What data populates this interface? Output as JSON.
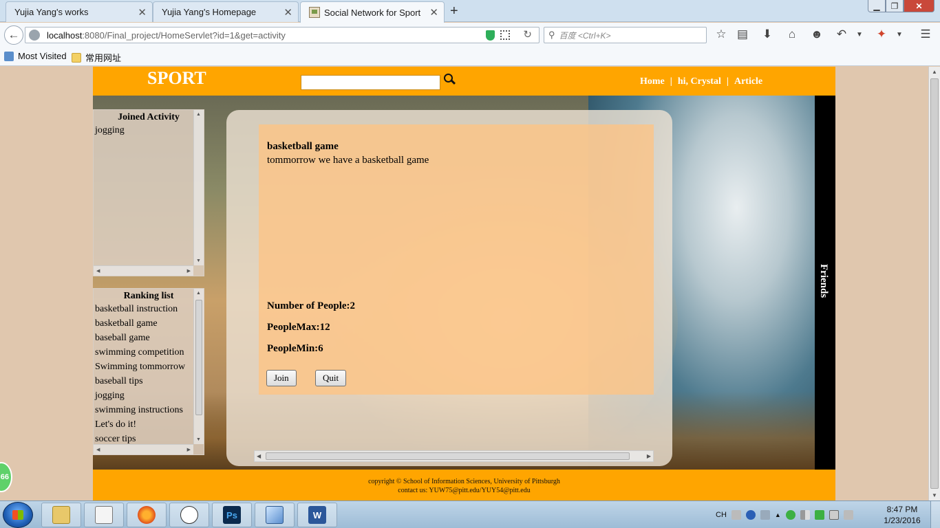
{
  "browser": {
    "tabs": [
      {
        "title": "Yujia Yang's works",
        "active": false
      },
      {
        "title": "Yujia Yang's Homepage",
        "active": false
      },
      {
        "title": "Social Network for Sport",
        "active": true
      }
    ],
    "url_host": "localhost",
    "url_rest": ":8080/Final_project/HomeServlet?id=1&get=activity",
    "search_placeholder": "百度 <Ctrl+K>",
    "bookmarks": [
      "Most Visited",
      "常用网址"
    ]
  },
  "site": {
    "logo": "SPORT",
    "nav": {
      "home": "Home",
      "sep1": "|",
      "user": "hi, Crystal",
      "sep2": "|",
      "article": "Article"
    },
    "friends_label": "Friends",
    "footer": {
      "line1": "copyright © School of Information Sciences, University of Pittsburgh",
      "line2": "contact us: YUW75@pitt.edu/YUY54@pitt.edu"
    }
  },
  "joined_activity": {
    "title": "Joined Activity",
    "items": [
      "jogging"
    ]
  },
  "ranking_list": {
    "title": "Ranking list",
    "items": [
      "basketball instruction",
      "basketball game",
      "baseball game",
      "swimming competition",
      "Swimming tommorrow",
      "baseball tips",
      "jogging",
      "swimming instructions",
      "Let's do it!",
      "soccer tips"
    ]
  },
  "activity": {
    "title": "basketball game",
    "description": "tommorrow we have a basketball game",
    "num_people": "Number of People:2",
    "people_max": "PeopleMax:12",
    "people_min": "PeopleMin:6",
    "join_label": "Join",
    "quit_label": "Quit"
  },
  "badge": "66",
  "taskbar": {
    "apps": [
      "file-explorer",
      "notepad",
      "firefox",
      "rabbit-app",
      "photoshop",
      "3d-box-app",
      "word"
    ],
    "tray_lang": "CH",
    "time": "8:47 PM",
    "date": "1/23/2016"
  }
}
